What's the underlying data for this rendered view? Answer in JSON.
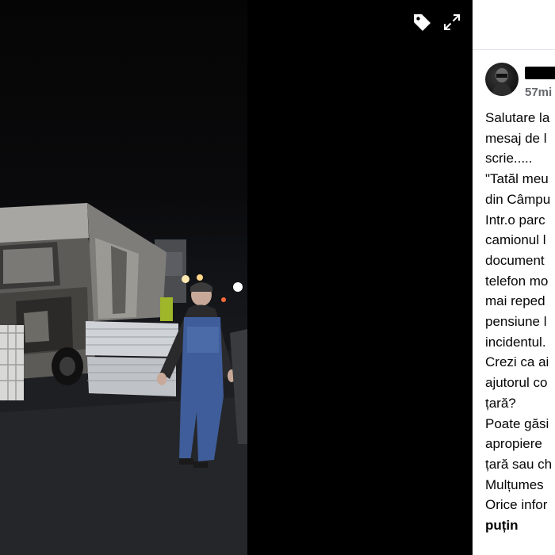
{
  "viewer": {
    "photo_alt": "",
    "tag_icon": "tag-icon",
    "expand_icon": "expand-icon"
  },
  "post": {
    "author_name": "",
    "timestamp": "57mi",
    "lines": [
      "Salutare la",
      "mesaj de l",
      "scrie.....",
      "\"Tatăl meu",
      "din Câmpu",
      "Intr.o parc",
      "camionul l",
      "document",
      "telefon mo",
      "mai reped",
      "pensiune l",
      "incidentul.",
      "Crezi ca ai",
      "ajutorul co",
      "țară?",
      "Poate găsi",
      "apropiere",
      "țară sau ch",
      "Mulțumes",
      "Orice infor",
      "puțin"
    ]
  },
  "colors": {
    "viewer_bg": "#000000",
    "panel_bg": "#ffffff",
    "text": "#050505",
    "secondary_text": "#65676b"
  }
}
